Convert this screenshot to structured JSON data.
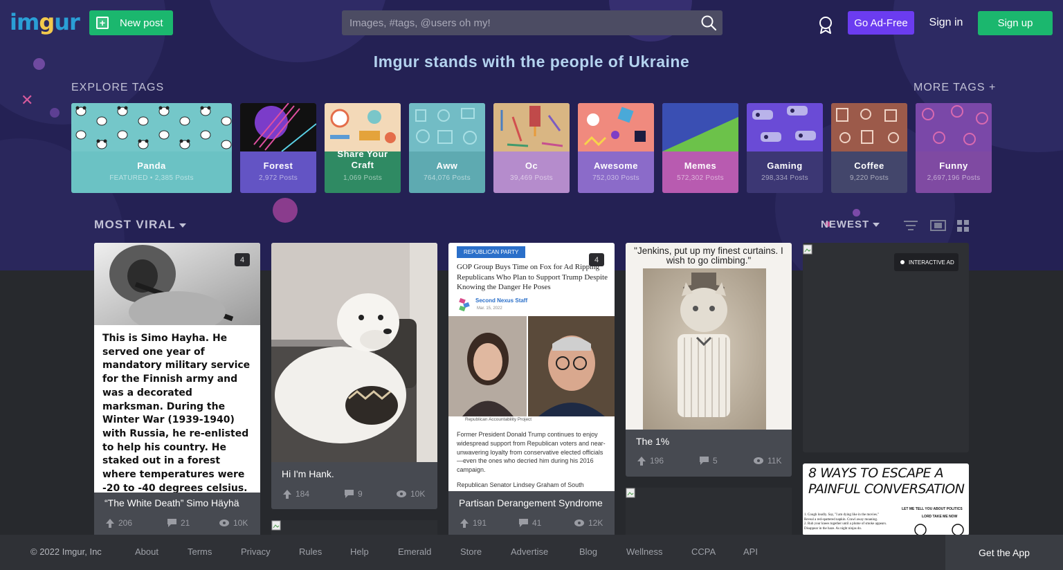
{
  "header": {
    "logo": "imgur",
    "new_post": "New post",
    "search_placeholder": "Images, #tags, @users oh my!",
    "go_ad_free": "Go Ad-Free",
    "sign_in": "Sign in",
    "sign_up": "Sign up"
  },
  "banner": "Imgur stands with the people of Ukraine",
  "explore": {
    "title": "EXPLORE TAGS",
    "more": "MORE TAGS +",
    "tags": [
      {
        "name": "Panda",
        "count": "FEATURED • 2,385 Posts",
        "color": "#6bc2c4"
      },
      {
        "name": "Forest",
        "count": "2,972 Posts",
        "color": "#6354c4"
      },
      {
        "name": "Share Your Craft",
        "count": "1,069 Posts",
        "color": "#2f8a63"
      },
      {
        "name": "Aww",
        "count": "764,076 Posts",
        "color": "#5eaab1"
      },
      {
        "name": "Oc",
        "count": "39,469 Posts",
        "color": "#b58ccc"
      },
      {
        "name": "Awesome",
        "count": "752,030 Posts",
        "color": "#8b6bc9"
      },
      {
        "name": "Memes",
        "count": "572,302 Posts",
        "color": "#b85bb0"
      },
      {
        "name": "Gaming",
        "count": "298,334 Posts",
        "color": "#3c3774"
      },
      {
        "name": "Coffee",
        "count": "9,220 Posts",
        "color": "#43466b"
      },
      {
        "name": "Funny",
        "count": "2,697,196 Posts",
        "color": "#7f4aa2"
      }
    ]
  },
  "feed": {
    "most_viral": "MOST VIRAL",
    "newest": "NEWEST"
  },
  "posts": [
    {
      "title": "“The White Death” Simo Häyhä",
      "badge": "4",
      "upvotes": "206",
      "comments": "21",
      "views": "10K",
      "note": "This is Simo Hayha. He served one year of mandatory military service for the Finnish army and was a decorated marksman. During the Winter War (1939-1940) with Russia, he re-enlisted to help his country. He staked out in a forest where temperatures were -20 to -40 degrees celsius. He began picking off Russian soldiers. Once they found out all their"
    },
    {
      "title": "Hi I'm Hank.",
      "upvotes": "184",
      "comments": "9",
      "views": "10K"
    },
    {
      "title": "Partisan Derangement Syndrome",
      "badge": "4",
      "upvotes": "191",
      "comments": "41",
      "views": "12K",
      "article": {
        "tag": "REPUBLICAN PARTY",
        "headline": "GOP Group Buys Time on Fox for Ad Ripping Republicans Who Plan to Support Trump Despite Knowing the Danger He Poses",
        "author": "Second Nexus Staff",
        "date": "Mar. 15, 2022",
        "caption": "Republican Accountability Project",
        "body": "Former President Donald Trump continues to enjoy widespread support from Republican voters and near-unwavering loyalty from conservative elected officials—even the ones who decried him during his 2016 campaign.",
        "body2": "Republican Senator Lindsey Graham of South"
      }
    },
    {
      "title": "The 1%",
      "upvotes": "196",
      "comments": "5",
      "views": "11K",
      "quote": "\"Jenkins, put up my finest curtains. I wish to go climbing.\""
    },
    {
      "ad_label": "INTERACTIVE AD",
      "comic_title": "8 WAYS TO ESCAPE A PAINFUL CONVERSATION",
      "comic_lines": [
        "1. Cough loudly. Say, \"I am dying like in the movies.\"",
        "Reveal a red-spattered napkin. Crawl away moaning.",
        "2. Rub your knees together until a plume of smoke appears.",
        "Disappear in the haze. As night ninjas do."
      ],
      "comic_bubble1": "LET ME TELL YOU ABOUT POLITICS",
      "comic_bubble2": "LORD TAKE ME NOW"
    }
  ],
  "footer": {
    "copyright": "© 2022 Imgur, Inc",
    "links": [
      "About",
      "Terms",
      "Privacy",
      "Rules",
      "Help",
      "Emerald",
      "Store",
      "Advertise",
      "Blog",
      "Wellness",
      "CCPA",
      "API"
    ],
    "get_app": "Get the App"
  }
}
